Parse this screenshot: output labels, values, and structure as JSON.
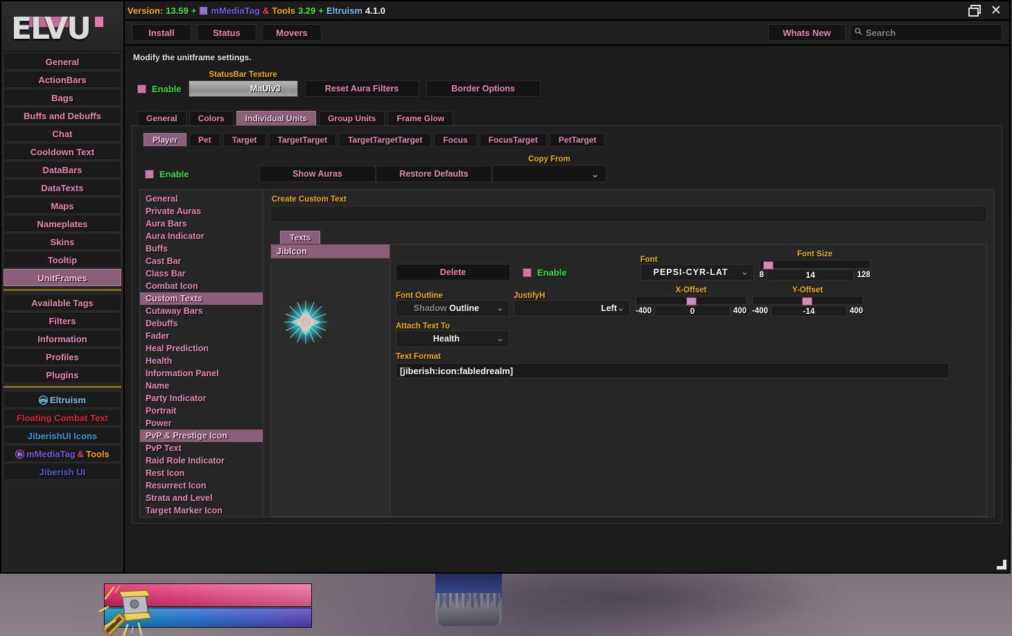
{
  "window": {
    "version_label": "Version:",
    "version_number": "13.59",
    "plus1": "+",
    "mmediatag": "mMediaTag",
    "amp": "&",
    "tools": "Tools",
    "tools_version": "3.29",
    "plus2": "+",
    "eltruism": "Eltruism",
    "eltruism_version": "4.1.0",
    "restore_icon": "restore-icon",
    "close_icon": "close-icon"
  },
  "logo": {
    "text": "ELVU"
  },
  "topbar": {
    "buttons": [
      "Install",
      "Status",
      "Movers"
    ],
    "whats_new": "Whats New",
    "search_placeholder": "Search",
    "search_value": "",
    "search_icon": "search-icon"
  },
  "sidebar": {
    "items": [
      {
        "label": "General",
        "selected": false
      },
      {
        "label": "ActionBars",
        "selected": false
      },
      {
        "label": "Bags",
        "selected": false
      },
      {
        "label": "Buffs and Debuffs",
        "selected": false
      },
      {
        "label": "Chat",
        "selected": false
      },
      {
        "label": "Cooldown Text",
        "selected": false
      },
      {
        "label": "DataBars",
        "selected": false
      },
      {
        "label": "DataTexts",
        "selected": false
      },
      {
        "label": "Maps",
        "selected": false
      },
      {
        "label": "Nameplates",
        "selected": false
      },
      {
        "label": "Skins",
        "selected": false
      },
      {
        "label": "Tooltip",
        "selected": false
      },
      {
        "label": "UnitFrames",
        "selected": true
      }
    ],
    "items2": [
      {
        "label": "Available Tags"
      },
      {
        "label": "Filters"
      },
      {
        "label": "Information"
      },
      {
        "label": "Profiles"
      },
      {
        "label": "Plugins"
      }
    ],
    "plugins": [
      {
        "label": "Eltruism",
        "style": "sb-eltruism",
        "icon": "eltruism-logo-icon"
      },
      {
        "label": "Floating Combat Text",
        "style": "sb-fct",
        "icon": ""
      },
      {
        "label": "JiberishUI Icons",
        "style": "sb-jib",
        "icon": ""
      },
      {
        "label": "mMediaTag & Tools",
        "style": "sb-mm1",
        "icon": "mmediatag-logo-icon"
      },
      {
        "label": "Jiberish UI",
        "style": "sb-jib2",
        "icon": ""
      }
    ],
    "mmediatag_parts": {
      "name": "mMediaTag",
      "amp": "&",
      "tools": "Tools"
    }
  },
  "panel": {
    "description": "Modify the unitframe settings.",
    "enable_label": "Enable",
    "enable_checked": true,
    "statusbar_texture_label": "StatusBar Texture",
    "statusbar_texture_value": "MaUIv3",
    "reset_aura_filters": "Reset Aura Filters",
    "border_options": "Border Options"
  },
  "tabs_level1": [
    {
      "label": "General",
      "active": false
    },
    {
      "label": "Colors",
      "active": false
    },
    {
      "label": "Individual Units",
      "active": true
    },
    {
      "label": "Group Units",
      "active": false
    },
    {
      "label": "Frame Glow",
      "active": false
    }
  ],
  "tabs_level2": [
    {
      "label": "Player",
      "active": true
    },
    {
      "label": "Pet",
      "active": false
    },
    {
      "label": "Target",
      "active": false
    },
    {
      "label": "TargetTarget",
      "active": false
    },
    {
      "label": "TargetTargetTarget",
      "active": false
    },
    {
      "label": "Focus",
      "active": false
    },
    {
      "label": "FocusTarget",
      "active": false
    },
    {
      "label": "PetTarget",
      "active": false
    }
  ],
  "unit_controls": {
    "enable_label": "Enable",
    "show_auras": "Show Auras",
    "restore_defaults": "Restore Defaults",
    "copy_from_label": "Copy From",
    "copy_from_value": ""
  },
  "navlist": {
    "items": [
      {
        "label": "General",
        "selected": false
      },
      {
        "label": "Private Auras",
        "selected": false
      },
      {
        "label": "Aura Bars",
        "selected": false
      },
      {
        "label": "Aura Indicator",
        "selected": false
      },
      {
        "label": "Buffs",
        "selected": false
      },
      {
        "label": "Cast Bar",
        "selected": false
      },
      {
        "label": "Class Bar",
        "selected": false
      },
      {
        "label": "Combat Icon",
        "selected": false
      },
      {
        "label": "Custom Texts",
        "selected": true
      },
      {
        "label": "Cutaway Bars",
        "selected": false
      },
      {
        "label": "Debuffs",
        "selected": false
      },
      {
        "label": "Fader",
        "selected": false
      },
      {
        "label": "Heal Prediction",
        "selected": false
      },
      {
        "label": "Health",
        "selected": false
      },
      {
        "label": "Information Panel",
        "selected": false
      },
      {
        "label": "Name",
        "selected": false
      },
      {
        "label": "Party Indicator",
        "selected": false
      },
      {
        "label": "Portrait",
        "selected": false
      },
      {
        "label": "Power",
        "selected": false
      },
      {
        "label": "PvP & Prestige Icon",
        "selected": true
      },
      {
        "label": "PvP Text",
        "selected": false
      },
      {
        "label": "Raid Role Indicator",
        "selected": false
      },
      {
        "label": "Rest Icon",
        "selected": false
      },
      {
        "label": "Resurrect Icon",
        "selected": false
      },
      {
        "label": "Strata and Level",
        "selected": false
      },
      {
        "label": "Target Marker Icon",
        "selected": false
      }
    ]
  },
  "custom_text": {
    "create_label": "Create Custom Text",
    "create_value": "",
    "texts_tab": "Texts",
    "preview_title": "JibIcon",
    "preview_icon": "cyan-starburst-icon",
    "delete_label": "Delete",
    "enable_label": "Enable",
    "enable_checked": true,
    "font_outline_label": "Font Outline",
    "font_outline_value": "Shadow Outline",
    "font_outline_dim": "Shadow",
    "font_outline_bright": "Outline",
    "justifyh_label": "JustifyH",
    "justifyh_value": "Left",
    "font_label": "Font",
    "font_value": "PEPSI-CYR-LAT",
    "font_size_label": "Font Size",
    "font_size_min": "8",
    "font_size_value": "14",
    "font_size_max": "128",
    "x_offset_label": "X-Offset",
    "x_offset_min": "-400",
    "x_offset_value": "0",
    "x_offset_max": "400",
    "y_offset_label": "Y-Offset",
    "y_offset_min": "-400",
    "y_offset_value": "-14",
    "y_offset_max": "400",
    "attach_label": "Attach Text To",
    "attach_value": "Health",
    "text_format_label": "Text Format",
    "text_format_value": "[jiberish:icon:fabledrealm]"
  },
  "resize_handle": "resize-handle",
  "unitframe": {
    "health_bar": "health-bar",
    "power_bar": "power-bar",
    "portrait": "hammer-portrait-icon"
  },
  "colors": {
    "accent_pink": "#e88ab8",
    "selected_pink": "#8b5f78",
    "gold_label": "#f0b41a",
    "green_enable": "#3ae03a",
    "health_bar": "#e01f63",
    "power_bar": "#2470d8",
    "starburst": "#4fe4e4"
  }
}
